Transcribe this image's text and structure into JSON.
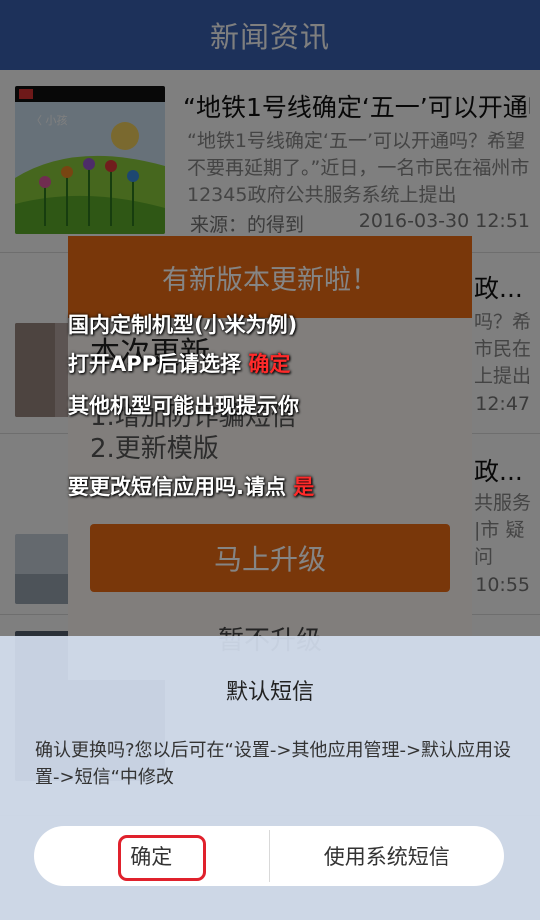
{
  "header": {
    "title": "新闻资讯"
  },
  "news": [
    {
      "title": "“地铁1号线确定‘五一’可以开通吗？",
      "summary": "“地铁1号线确定‘五一’可以开通吗？希望不要再延期了。”近日，一名市民在福州市12345政府公共服务系统上提出",
      "source": "来源：的得到",
      "date": "2016-03-30 12:51"
    },
    {
      "title": "政...",
      "summary": "吗？希 市民在 上提出",
      "source": "",
      "date": "12:47"
    },
    {
      "title": "政...",
      "summary": "共服务 |市 疑问",
      "source": "",
      "date": "10:55"
    }
  ],
  "update_dialog": {
    "title": "有新版本更新啦！",
    "section_title": "本次更新",
    "items": [
      "1.增加防诈骗短信",
      "2.更新模版"
    ],
    "upgrade_label": "马上升级",
    "skip_label": "暂不升级"
  },
  "instructions": {
    "line1": "国内定制机型(小米为例)",
    "line2_prefix": "打开APP后请选择 ",
    "line2_highlight": "确定",
    "line3": "其他机型可能出现提示你",
    "line4_prefix": "要更改短信应用吗.请点 ",
    "line4_highlight": "是"
  },
  "sms_dialog": {
    "title": "默认短信",
    "message": "确认更换吗?您以后可在“设置->其他应用管理->默认应用设置->短信“中修改",
    "confirm_label": "确定",
    "system_sms_label": "使用系统短信"
  },
  "colors": {
    "header_blue": "#3a63b5",
    "accent_orange": "#e86a15",
    "highlight_red": "#ff2a2a",
    "ring_red": "#e0212c"
  }
}
